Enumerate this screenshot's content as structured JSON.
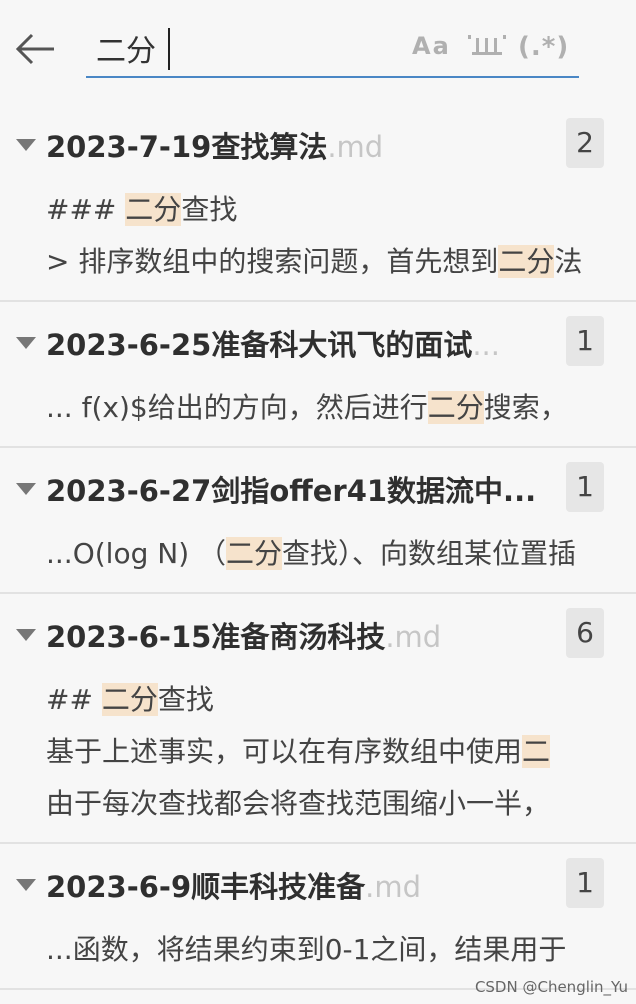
{
  "search": {
    "query": "二分",
    "placeholder": "",
    "options": {
      "match_case": "Aa",
      "whole_word_icon": "whole-word-icon",
      "regex": "(.*)"
    }
  },
  "icons": {
    "back": "arrow-left-icon",
    "expand": "caret-down-icon"
  },
  "colors": {
    "accent": "#4a87c5",
    "highlight": "#f6e3cc",
    "badge_bg": "#e6e6e6"
  },
  "results": [
    {
      "name": "2023-7-19查找算法",
      "ext": ".md",
      "count": "2",
      "matches": [
        {
          "pre": "### ",
          "hit": "二分",
          "post": "查找"
        },
        {
          "pre": "> 排序数组中的搜索问题，首先想到",
          "hit": "二分",
          "post": "法"
        }
      ]
    },
    {
      "name": "2023-6-25准备科大讯飞的面试",
      "ext": "...",
      "count": "1",
      "matches": [
        {
          "pre": "... f(x)$给出的方向，然后进行",
          "hit": "二分",
          "post": "搜索，"
        }
      ]
    },
    {
      "name": "2023-6-27剑指offer41数据流中...",
      "ext": "",
      "count": "1",
      "matches": [
        {
          "pre": "...O(log N) （",
          "hit": "二分",
          "post": "查找）、向数组某位置插"
        }
      ]
    },
    {
      "name": "2023-6-15准备商汤科技",
      "ext": ".md",
      "count": "6",
      "matches": [
        {
          "pre": "## ",
          "hit": "二分",
          "post": "查找"
        },
        {
          "pre": "基于上述事实，可以在有序数组中使用",
          "hit": "二",
          "post": ""
        },
        {
          "pre": "由于每次查找都会将查找范围缩小一半，",
          "hit": "",
          "post": ""
        }
      ]
    },
    {
      "name": "2023-6-9顺丰科技准备",
      "ext": ".md",
      "count": "1",
      "matches": [
        {
          "pre": "...函数，将结果约束到0-1之间，结果用于",
          "hit": "",
          "post": ""
        }
      ]
    }
  ],
  "watermark": "CSDN @Chenglin_Yu"
}
